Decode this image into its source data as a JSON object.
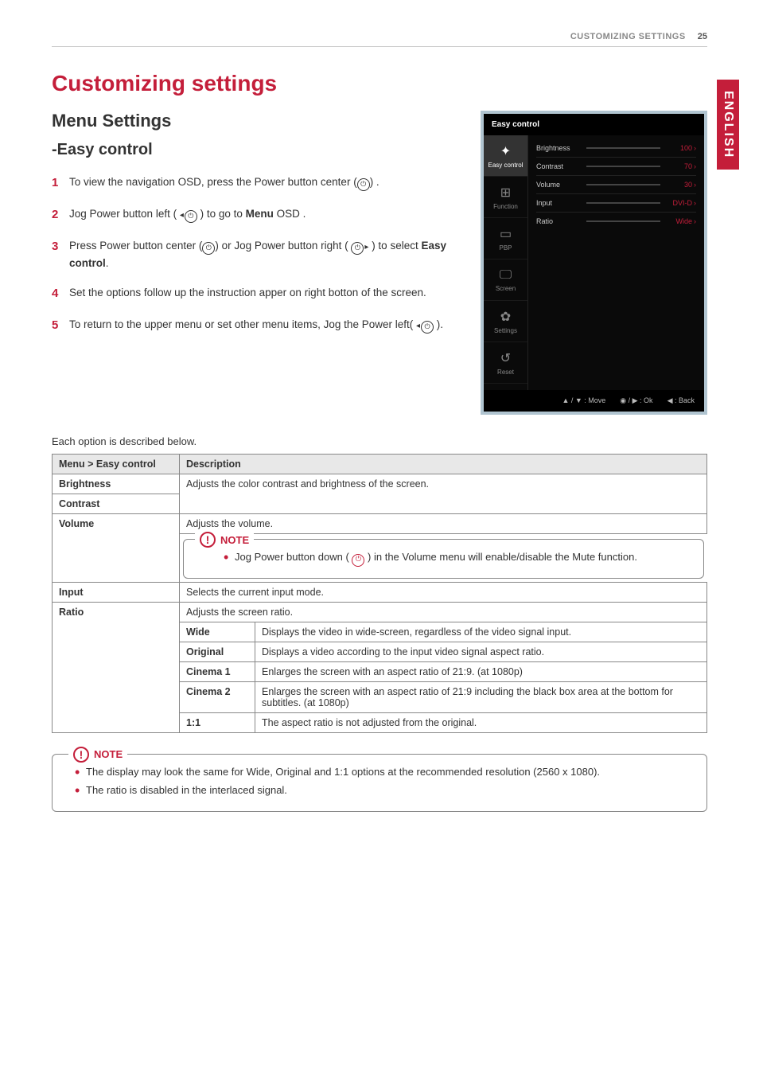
{
  "header": {
    "section": "CUSTOMIZING SETTINGS",
    "page": "25"
  },
  "language_tab": "ENGLISH",
  "title": "Customizing settings",
  "subtitle": "Menu Settings",
  "subsubtitle": "-Easy control",
  "steps": [
    {
      "n": "1",
      "before": "To view the navigation OSD, press the Power button center (",
      "after": ") ."
    },
    {
      "n": "2",
      "before": "Jog Power button left ( ",
      "after": " ) to go to ",
      "bold": "Menu",
      "tail": " OSD ."
    },
    {
      "n": "3",
      "before": "Press Power button center (",
      "mid": ") or Jog Power button right ( ",
      "after": " ) to select ",
      "bold": "Easy control",
      "tail": "."
    },
    {
      "n": "4",
      "before": "Set the options follow up the instruction apper on right botton of the screen."
    },
    {
      "n": "5",
      "before": "To return to the upper menu or set other menu items, Jog the Power left( ",
      "after": " )."
    }
  ],
  "osd": {
    "header": "Easy control",
    "side": [
      {
        "label": "Easy control",
        "icon": "✦"
      },
      {
        "label": "Function",
        "icon": "⊞"
      },
      {
        "label": "PBP",
        "icon": "▭"
      },
      {
        "label": "Screen",
        "icon": "🖵"
      },
      {
        "label": "Settings",
        "icon": "✿"
      },
      {
        "label": "Reset",
        "icon": "↺"
      }
    ],
    "rows": [
      {
        "label": "Brightness",
        "val": "100",
        "fill": 100
      },
      {
        "label": "Contrast",
        "val": "70",
        "fill": 70
      },
      {
        "label": "Volume",
        "val": "30",
        "fill": 30
      },
      {
        "label": "Input",
        "val": "DVI-D",
        "bar": false
      },
      {
        "label": "Ratio",
        "val": "Wide",
        "bar": false
      }
    ],
    "footer": {
      "move": "▲ / ▼ : Move",
      "ok": "◉ / ▶ : Ok",
      "back": "◀ : Back"
    }
  },
  "desc_intro": "Each option is described below.",
  "table": {
    "head": {
      "c1": "Menu > Easy control",
      "c2": "Description"
    },
    "brightness": "Brightness",
    "contrast": "Contrast",
    "bright_contrast_desc": "Adjusts the color contrast and brightness of the screen.",
    "volume": {
      "label": "Volume",
      "desc": "Adjusts the volume.",
      "note": "NOTE",
      "note_text_a": "Jog Power button down ( ",
      "note_text_b": " ) in the Volume menu will enable/disable the Mute function."
    },
    "input": {
      "label": "Input",
      "desc": "Selects the current input mode."
    },
    "ratio": {
      "label": "Ratio",
      "desc": "Adjusts the screen ratio.",
      "rows": [
        {
          "k": "Wide",
          "v": "Displays the video in wide-screen, regardless of the video signal input."
        },
        {
          "k": "Original",
          "v": "Displays a video according to the input video signal aspect ratio."
        },
        {
          "k": "Cinema 1",
          "v": "Enlarges the screen with an aspect ratio of 21:9. (at 1080p)"
        },
        {
          "k": "Cinema 2",
          "v": "Enlarges the screen with an aspect ratio of 21:9 including the black box area at the bottom for subtitles. (at 1080p)"
        },
        {
          "k": "1:1",
          "v": "The aspect ratio is not adjusted from the original."
        }
      ]
    }
  },
  "bottom_note": {
    "label": "NOTE",
    "items": [
      "The display may look the same for Wide, Original and 1:1 options at the recommended resolution (2560 x 1080).",
      "The ratio is disabled in the interlaced signal."
    ]
  }
}
